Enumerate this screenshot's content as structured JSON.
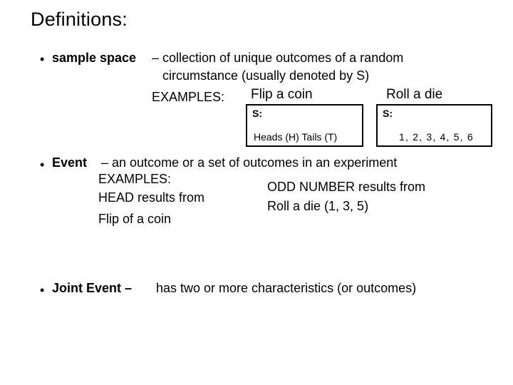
{
  "slide": {
    "title": "Definitions:",
    "background_color": "#ffffff",
    "text_color": "#000000"
  },
  "bullets": {
    "sample_space": {
      "marker": "•",
      "term": "sample space",
      "definition_line1": "– collection of unique outcomes of a random",
      "definition_line2": "circumstance  (usually denoted by S)",
      "examples_label": "EXAMPLES:"
    },
    "event": {
      "marker": "•",
      "term": "Event",
      "definition": "– an outcome or a set of outcomes in an experiment",
      "examples_label": "EXAMPLES:",
      "example_left_line1": "HEAD results from",
      "example_left_line2": "Flip of a coin",
      "example_right_line1": "ODD NUMBER results from",
      "example_right_line2": "Roll a die (1, 3, 5)"
    },
    "joint_event": {
      "marker": "•",
      "term": "Joint Event –",
      "definition": "has two or more characteristics (or outcomes)"
    }
  },
  "sample_space_boxes": [
    {
      "caption": "Flip a coin",
      "set_label": "S:",
      "outcomes": "Heads (H)   Tails (T)"
    },
    {
      "caption": "Roll a die",
      "set_label": "S:",
      "outcomes": "1, 2, 3, 4, 5, 6"
    }
  ]
}
